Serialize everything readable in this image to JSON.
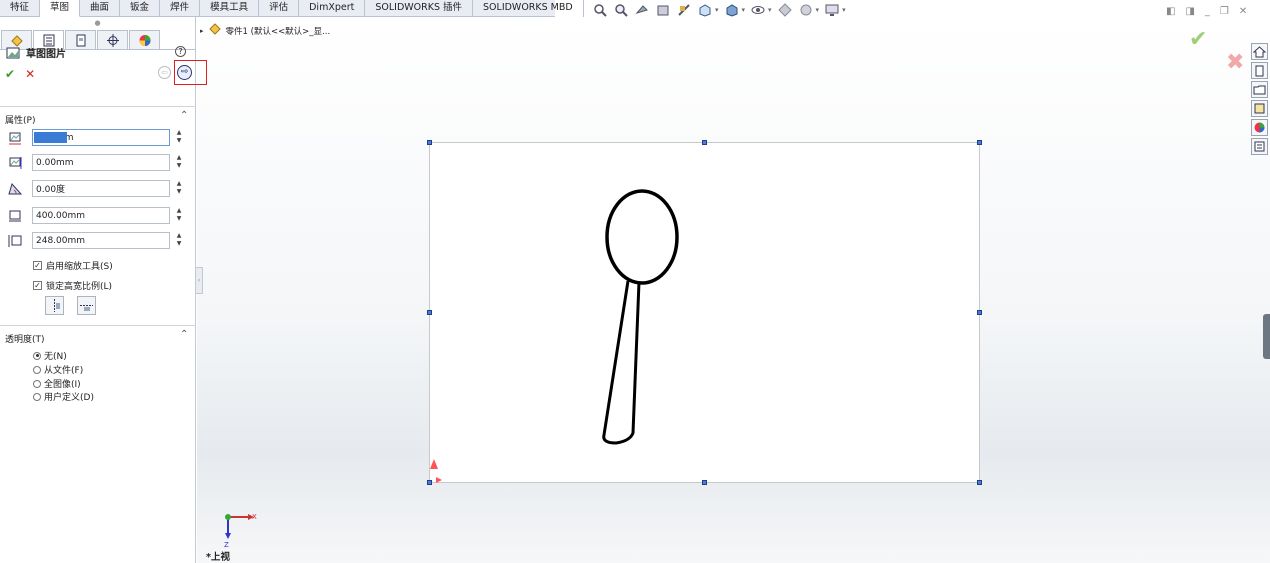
{
  "command_tabs": [
    "特征",
    "草图",
    "曲面",
    "钣金",
    "焊件",
    "模具工具",
    "评估",
    "DimXpert",
    "SOLIDWORKS 插件",
    "SOLIDWORKS MBD"
  ],
  "active_tab_index": 1,
  "property_manager": {
    "title": "草图图片",
    "help_label": "?",
    "ok_label": "✔",
    "cancel_label": "✕",
    "properties_section": "属性(P)",
    "fields": {
      "x_pos": "0.00mm",
      "y_pos": "0.00mm",
      "angle": "0.00度",
      "width": "400.00mm",
      "height": "248.00mm"
    },
    "enable_scale_tool": "启用缩放工具(S)",
    "lock_aspect_ratio": "锁定高宽比例(L)",
    "transparency_section": "透明度(T)",
    "transparency_options": [
      "无(N)",
      "从文件(F)",
      "全图像(I)",
      "用户定义(D)"
    ],
    "transparency_selected_index": 0
  },
  "feature_tree": {
    "item": "零件1 (默认<<默认>_显..."
  },
  "viewport": {
    "view_name": "*上视",
    "triad_x": "X",
    "triad_z": "Z"
  },
  "colors": {
    "accent": "#3a7bd5",
    "highlight_box": "#e02020",
    "ok_green": "#3a9a2a",
    "cancel_red": "#d0281e"
  }
}
